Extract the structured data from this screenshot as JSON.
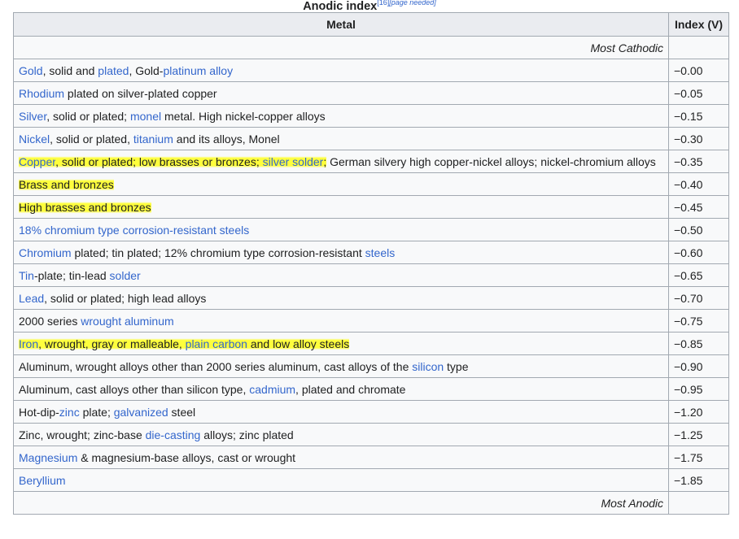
{
  "caption": {
    "title": "Anodic index",
    "ref": "[16]",
    "note": "[page needed]"
  },
  "headers": {
    "metal": "Metal",
    "index": "Index (V)"
  },
  "top_note": "Most Cathodic",
  "bottom_note": "Most Anodic",
  "rows": [
    {
      "parts": [
        {
          "t": "Gold",
          "link": true
        },
        {
          "t": ", solid and "
        },
        {
          "t": "plated",
          "link": true
        },
        {
          "t": ", Gold-"
        },
        {
          "t": "platinum",
          "link": true
        },
        {
          "t": " "
        },
        {
          "t": "alloy",
          "link": true
        }
      ],
      "index": "−0.00"
    },
    {
      "parts": [
        {
          "t": "Rhodium",
          "link": true
        },
        {
          "t": " plated on silver-plated copper"
        }
      ],
      "index": "−0.05"
    },
    {
      "parts": [
        {
          "t": "Silver",
          "link": true
        },
        {
          "t": ", solid or plated; "
        },
        {
          "t": "monel",
          "link": true
        },
        {
          "t": " metal. High nickel-copper alloys"
        }
      ],
      "index": "−0.15"
    },
    {
      "parts": [
        {
          "t": "Nickel",
          "link": true
        },
        {
          "t": ", solid or plated, "
        },
        {
          "t": "titanium",
          "link": true
        },
        {
          "t": " and its alloys, Monel"
        }
      ],
      "index": "−0.30"
    },
    {
      "parts": [
        {
          "t": "Copper",
          "link": true,
          "hl": true
        },
        {
          "t": ", solid or plated; low brasses or bronzes; ",
          "hl": true
        },
        {
          "t": "silver solder",
          "link": true,
          "hl": true
        },
        {
          "t": ";",
          "hl": true
        },
        {
          "t": " German silvery high copper-nickel alloys; nickel-chromium alloys"
        }
      ],
      "index": "−0.35"
    },
    {
      "parts": [
        {
          "t": "Brass and bronzes",
          "hl": true
        }
      ],
      "index": "−0.40"
    },
    {
      "parts": [
        {
          "t": "High brasses and bronzes",
          "hl": true
        }
      ],
      "index": "−0.45"
    },
    {
      "parts": [
        {
          "t": "18% chromium type corrosion-resistant steels",
          "link": true
        }
      ],
      "index": "−0.50"
    },
    {
      "parts": [
        {
          "t": "Chromium",
          "link": true
        },
        {
          "t": " plated; tin plated; 12% chromium type corrosion-resistant "
        },
        {
          "t": "steels",
          "link": true
        }
      ],
      "index": "−0.60"
    },
    {
      "parts": [
        {
          "t": "Tin",
          "link": true
        },
        {
          "t": "-plate; tin-lead "
        },
        {
          "t": "solder",
          "link": true
        }
      ],
      "index": "−0.65"
    },
    {
      "parts": [
        {
          "t": "Lead",
          "link": true
        },
        {
          "t": ", solid or plated; high lead alloys"
        }
      ],
      "index": "−0.70"
    },
    {
      "parts": [
        {
          "t": "2000 series "
        },
        {
          "t": "wrought aluminum",
          "link": true
        }
      ],
      "index": "−0.75"
    },
    {
      "parts": [
        {
          "t": "Iron",
          "link": true,
          "hl": true
        },
        {
          "t": ", wrought, gray or malleable, ",
          "hl": true
        },
        {
          "t": "plain carbon",
          "link": true,
          "hl": true
        },
        {
          "t": " and low alloy steels",
          "hl": true
        }
      ],
      "index": "−0.85"
    },
    {
      "parts": [
        {
          "t": "Aluminum, wrought alloys other than 2000 series aluminum, cast alloys of the "
        },
        {
          "t": "silicon",
          "link": true
        },
        {
          "t": " type"
        }
      ],
      "index": "−0.90"
    },
    {
      "parts": [
        {
          "t": "Aluminum, cast alloys other than silicon type, "
        },
        {
          "t": "cadmium",
          "link": true
        },
        {
          "t": ", plated and chromate"
        }
      ],
      "index": "−0.95"
    },
    {
      "parts": [
        {
          "t": "Hot-dip-"
        },
        {
          "t": "zinc",
          "link": true
        },
        {
          "t": " plate; "
        },
        {
          "t": "galvanized",
          "link": true
        },
        {
          "t": " steel"
        }
      ],
      "index": "−1.20"
    },
    {
      "parts": [
        {
          "t": "Zinc, wrought; zinc-base "
        },
        {
          "t": "die-casting",
          "link": true
        },
        {
          "t": " alloys; zinc plated"
        }
      ],
      "index": "−1.25"
    },
    {
      "parts": [
        {
          "t": "Magnesium",
          "link": true
        },
        {
          "t": " & magnesium-base alloys, cast or wrought"
        }
      ],
      "index": "−1.75"
    },
    {
      "parts": [
        {
          "t": "Beryllium",
          "link": true
        }
      ],
      "index": "−1.85"
    }
  ]
}
